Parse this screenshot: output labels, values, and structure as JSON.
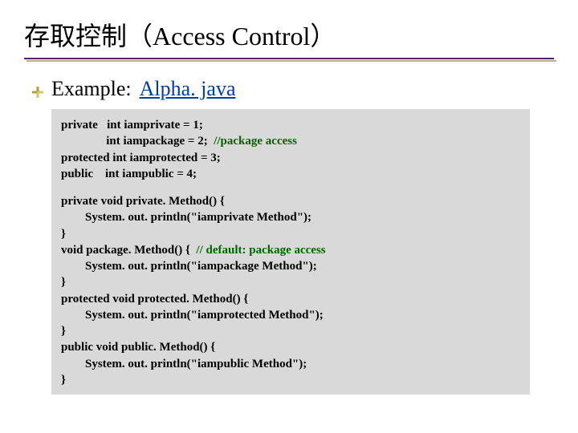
{
  "title": "存取控制（Access Control）",
  "example_label": "Example:",
  "example_link": "Alpha. java",
  "code": {
    "l1a": "private   int iamprivate = 1;",
    "l2a": "               int iampackage = 2;  ",
    "l2b": "//package access",
    "l3": "protected int iamprotected = 3;",
    "l4": "public    int iampublic = 4;",
    "l5": "private void private. Method() {",
    "l6": "        System. out. println(\"iamprivate Method\");",
    "l7": "}",
    "l8a": "void package. Method() {  ",
    "l8b": "// default: package access",
    "l9": "        System. out. println(\"iampackage Method\");",
    "l10": "}",
    "l11": "protected void protected. Method() {",
    "l12": "        System. out. println(\"iamprotected Method\");",
    "l13": "}",
    "l14": "public void public. Method() {",
    "l15": "        System. out. println(\"iampublic Method\");",
    "l16": "}"
  }
}
